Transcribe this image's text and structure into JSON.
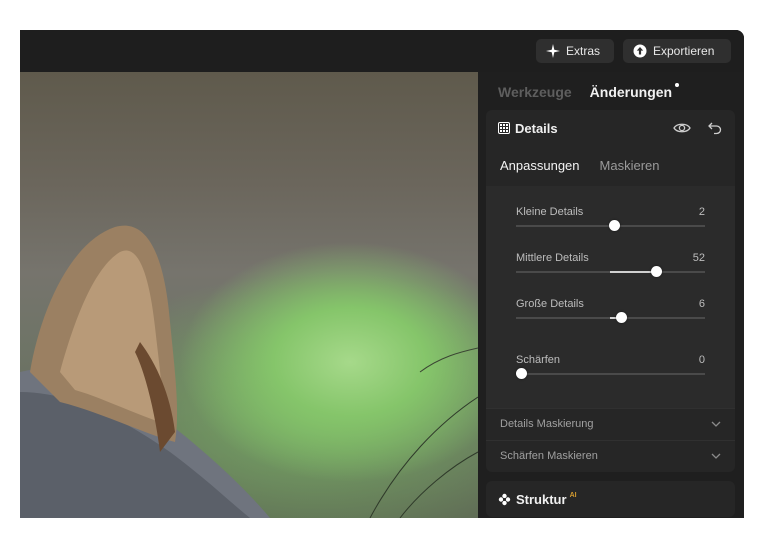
{
  "toolbar": {
    "extras_label": "Extras",
    "export_label": "Exportieren"
  },
  "panel": {
    "tabs": [
      {
        "label": "Werkzeuge",
        "active": false
      },
      {
        "label": "Änderungen",
        "active": true
      }
    ],
    "details": {
      "title": "Details",
      "subtabs": [
        {
          "label": "Anpassungen",
          "active": true
        },
        {
          "label": "Maskieren",
          "active": false
        }
      ],
      "sliders": [
        {
          "label": "Kleine Details",
          "value": "2",
          "level": 0.52
        },
        {
          "label": "Mittlere Details",
          "value": "52",
          "level": 0.76
        },
        {
          "label": "Große Details",
          "value": "6",
          "level": 0.56
        },
        {
          "label": "Schärfen",
          "value": "0",
          "level": 0.0
        }
      ],
      "collapsibles": [
        {
          "label": "Details Maskierung"
        },
        {
          "label": "Schärfen Maskieren"
        }
      ]
    },
    "struktur": {
      "title": "Struktur",
      "badge": "AI"
    }
  },
  "colors": {
    "background": "#1f1f1f",
    "panel_card": "#262626",
    "button": "#2f2f2f",
    "ai_badge": "#d39a2f"
  },
  "icons": [
    "sparkle-icon",
    "upload-icon",
    "grid-details-icon",
    "eye-icon",
    "undo-icon",
    "chevron-down-icon",
    "flower-struktur-icon"
  ]
}
